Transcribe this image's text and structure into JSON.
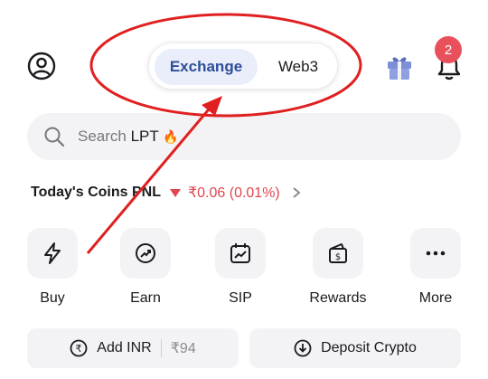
{
  "header": {
    "tabs": [
      {
        "label": "Exchange",
        "selected": true
      },
      {
        "label": "Web3",
        "selected": false
      }
    ],
    "notification_count": "2",
    "icons": {
      "profile": "user-circle-icon",
      "gift": "gift-icon",
      "bell": "bell-icon"
    }
  },
  "search": {
    "prefix": "Search ",
    "highlight": "LPT",
    "emoji": "🔥"
  },
  "pnl": {
    "label": "Today's Coins PNL",
    "value": "₹0.06 (0.01%)",
    "trend": "down"
  },
  "actions": [
    {
      "label": "Buy",
      "icon": "lightning-icon"
    },
    {
      "label": "Earn",
      "icon": "earn-icon"
    },
    {
      "label": "SIP",
      "icon": "calendar-chart-icon"
    },
    {
      "label": "Rewards",
      "icon": "rewards-icon"
    },
    {
      "label": "More",
      "icon": "more-icon"
    }
  ],
  "cta": {
    "add_inr": "Add INR",
    "inr_balance": "₹94",
    "deposit_crypto": "Deposit Crypto"
  },
  "colors": {
    "accent": "#2f4d9a",
    "loss": "#e0464f",
    "badge": "#e8505b",
    "annotation": "#e02020"
  }
}
